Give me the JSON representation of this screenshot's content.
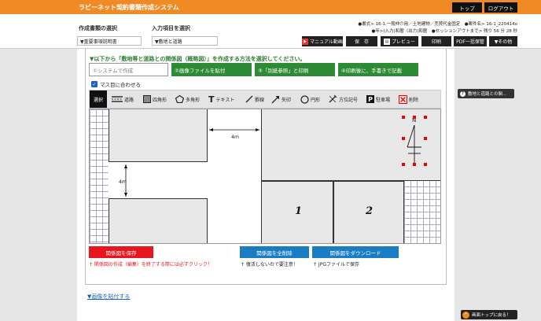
{
  "app": {
    "title": "ラビーネット契約書類作成システム",
    "top_button": "トップ",
    "logout_button": "ログアウト"
  },
  "header": {
    "format_info": "●書式> 16-1.一般仲介用／土地建物／売買代金固定　●案件名> 16-1_220414o",
    "session_info": "●年>(入力)和暦（出力)和暦　●セッションアウトまで> 残り 56 分 28 秒",
    "doc_select_label": "作成書類の選択",
    "doc_select_value": "▼重要事項説明書",
    "item_select_label": "入力項目を選択",
    "item_select_value": "▼敷地と道路"
  },
  "toolbar_top": {
    "manual_video": "マニュアル動画",
    "save": "保　存",
    "preview": "プレビュー",
    "print": "印刷",
    "pdf_batch": "PDF一括保管",
    "others": "▼その他"
  },
  "instruction": "▼以下から「敷地等と道路との関係図（概略図）」を作成する方法を選択してください。",
  "methods": [
    "①システムで作成",
    "②画像ファイルを貼付",
    "③「別紙参照」と印刷",
    "④印刷後に、手書きで記載"
  ],
  "fit_grid": {
    "label": "マス目に合わせる",
    "checked": true
  },
  "tools": {
    "select": "選択",
    "road": "道路",
    "rect": "四角形",
    "polygon": "多角形",
    "text": "テキスト",
    "line": "罫線",
    "arrow": "矢印",
    "circle": "円形",
    "compass": "方位記号",
    "parking": "駐車場",
    "delete": "削除"
  },
  "drawing": {
    "dim_horizontal": "4ｍ",
    "dim_vertical": "4ｍ",
    "lot1": "1",
    "lot2": "2",
    "north": "N"
  },
  "actions": {
    "save_diagram": "関係図を保存",
    "delete_all": "関係図を全削除",
    "download": "関係図をダウンロード",
    "note_save": "↑ 関係図の作成（編集）を終了する際には必ずクリック！",
    "note_delete": "↑ 復活しないので要注意！",
    "note_download": "↑ JPGファイルで保存"
  },
  "paste_image_link": "▼画像を貼付する",
  "side_help": "敷地と道路との関…",
  "back_to_top": "画面トップに戻る！",
  "colors": {
    "accent": "#f08a24",
    "green": "#2e8b35",
    "red": "#e8141e",
    "blue": "#1a7dc4"
  }
}
